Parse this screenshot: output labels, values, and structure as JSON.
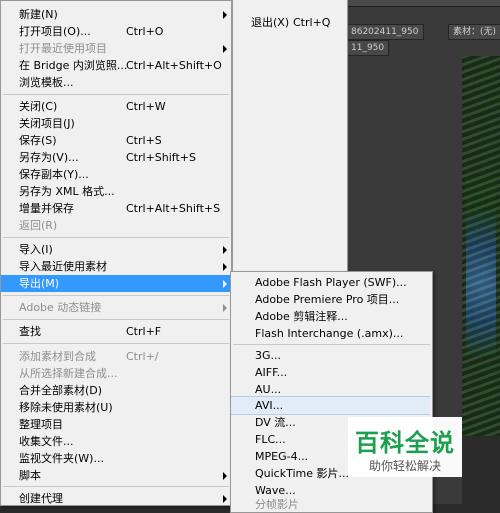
{
  "panel": {
    "tab1": "86202411_950",
    "tab2": "11_950",
    "tab3": "素材：(无)"
  },
  "main_menu": {
    "items": [
      {
        "label": "新建(N)",
        "shortcut": "",
        "submenu": true,
        "disabled": false
      },
      {
        "label": "打开项目(O)...",
        "shortcut": "Ctrl+O",
        "submenu": false,
        "disabled": false
      },
      {
        "label": "打开最近使用项目",
        "shortcut": "",
        "submenu": true,
        "disabled": false
      },
      {
        "label": "在 Bridge 内浏览照...",
        "shortcut": "Ctrl+Alt+Shift+O",
        "submenu": false,
        "disabled": false
      },
      {
        "label": "浏览模板...",
        "shortcut": "",
        "submenu": false,
        "disabled": false
      },
      {
        "label": "关闭(C)",
        "shortcut": "Ctrl+W",
        "submenu": false,
        "disabled": false
      },
      {
        "label": "关闭项目(J)",
        "shortcut": "",
        "submenu": false,
        "disabled": false
      },
      {
        "label": "保存(S)",
        "shortcut": "Ctrl+S",
        "submenu": false,
        "disabled": false
      },
      {
        "label": "另存为(V)...",
        "shortcut": "Ctrl+Shift+S",
        "submenu": false,
        "disabled": false
      },
      {
        "label": "保存副本(Y)...",
        "shortcut": "",
        "submenu": false,
        "disabled": false
      },
      {
        "label": "另存为 XML 格式...",
        "shortcut": "",
        "submenu": false,
        "disabled": false
      },
      {
        "label": "增量并保存",
        "shortcut": "Ctrl+Alt+Shift+S",
        "submenu": false,
        "disabled": false
      },
      {
        "label": "返回(R)",
        "shortcut": "",
        "submenu": false,
        "disabled": true
      },
      {
        "label": "导入(I)",
        "shortcut": "",
        "submenu": true,
        "disabled": false
      },
      {
        "label": "导入最近使用素材",
        "shortcut": "",
        "submenu": true,
        "disabled": false
      },
      {
        "label": "导出(M)",
        "shortcut": "",
        "submenu": true,
        "disabled": false,
        "highlighted": true
      },
      {
        "label": "Adobe 动态链接",
        "shortcut": "",
        "submenu": true,
        "disabled": true
      },
      {
        "label": "查找",
        "shortcut": "Ctrl+F",
        "submenu": false,
        "disabled": false
      },
      {
        "label": "添加素材到合成",
        "shortcut": "Ctrl+/",
        "submenu": false,
        "disabled": true
      },
      {
        "label": "从所选择新建合成...",
        "shortcut": "",
        "submenu": false,
        "disabled": true
      },
      {
        "label": "合并全部素材(D)",
        "shortcut": "",
        "submenu": false,
        "disabled": false
      },
      {
        "label": "移除未使用素材(U)",
        "shortcut": "",
        "submenu": false,
        "disabled": false
      },
      {
        "label": "整理项目",
        "shortcut": "",
        "submenu": false,
        "disabled": false
      },
      {
        "label": "收集文件...",
        "shortcut": "",
        "submenu": false,
        "disabled": false
      },
      {
        "label": "监视文件夹(W)...",
        "shortcut": "",
        "submenu": false,
        "disabled": false
      },
      {
        "label": "脚本",
        "shortcut": "",
        "submenu": true,
        "disabled": false
      },
      {
        "label": "创建代理",
        "shortcut": "",
        "submenu": true,
        "disabled": false
      }
    ]
  },
  "quit_menu": {
    "label": "退出(X)",
    "shortcut": "Ctrl+Q"
  },
  "export_menu": {
    "items": [
      {
        "label": "Adobe Flash Player (SWF)..."
      },
      {
        "label": "Adobe Premiere Pro 项目..."
      },
      {
        "label": "Adobe 剪辑注释..."
      },
      {
        "label": "Flash Interchange (.amx)..."
      },
      {
        "label": "3G..."
      },
      {
        "label": "AIFF..."
      },
      {
        "label": "AU..."
      },
      {
        "label": "AVI...",
        "hovered": true
      },
      {
        "label": "DV 流..."
      },
      {
        "label": "FLC..."
      },
      {
        "label": "MPEG-4..."
      },
      {
        "label": "QuickTime 影片..."
      },
      {
        "label": "Wave..."
      },
      {
        "label": "分帧影片"
      }
    ]
  },
  "watermark": {
    "title": "百科全说",
    "subtitle": "助你轻松解决"
  },
  "colors": {
    "highlight": "#3399ff",
    "menu_bg": "#f0f0f0",
    "watermark_green": "#1c9f4e"
  }
}
